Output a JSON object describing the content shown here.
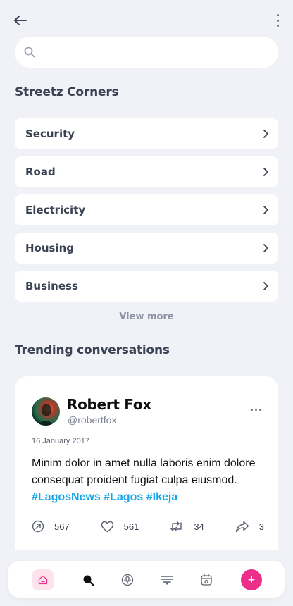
{
  "search": {
    "placeholder": ""
  },
  "sections": {
    "corners_title": "Streetz Corners",
    "trending_title": "Trending conversations"
  },
  "corners": [
    {
      "label": "Security"
    },
    {
      "label": "Road"
    },
    {
      "label": "Electricity"
    },
    {
      "label": "Housing"
    },
    {
      "label": "Business"
    }
  ],
  "view_more": "View more",
  "post": {
    "name": "Robert Fox",
    "handle": "@robertfox",
    "date": "16 January 2017",
    "text": "Minim dolor in amet nulla laboris enim dolore consequat proident fugiat culpa eiusmod.",
    "hashtags": [
      "#LagosNews",
      "#Lagos",
      "#Ikeja"
    ],
    "stats": {
      "views": "567",
      "likes": "561",
      "reposts": "34",
      "shares": "3"
    }
  },
  "colors": {
    "background": "#f1f2f7",
    "hashtag": "#1aa6e6",
    "accent_pink": "#ee2f8a",
    "home_tab_bg": "#fde3ee"
  },
  "icons": {
    "back": "arrow-left-icon",
    "menu": "kebab-vertical-icon",
    "search": "search-icon",
    "row_chevron": "chevron-right-icon",
    "nav": [
      "home-icon",
      "search-icon",
      "podcast-icon",
      "forum-icon",
      "calendar-icon",
      "add-icon"
    ]
  }
}
